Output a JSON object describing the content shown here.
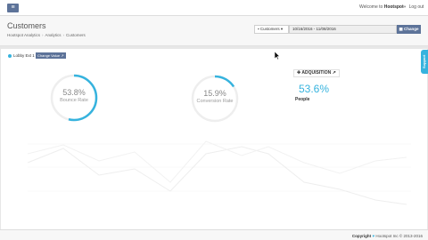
{
  "topbar": {
    "menu_icon": "hamburger-icon",
    "welcome_prefix": "Welcome to",
    "welcome_brand": "Hootspot",
    "logout_label": "Log out",
    "logout_icon": "sign-out-icon"
  },
  "header": {
    "title": "Customers",
    "breadcrumb": [
      "Hootspot Analytics",
      "Analytics",
      "Customers"
    ],
    "select_label": "Customers",
    "select_icon": "users-icon",
    "date_range": "10/16/2016 - 11/08/2016",
    "change_label": "Change",
    "change_icon": "calendar-icon"
  },
  "filter": {
    "location_label": "Lobby Ext 1",
    "change_value_label": "Change Value"
  },
  "gauges": [
    {
      "value": "53.8%",
      "label": "Bounce Rate",
      "fraction": 0.538
    },
    {
      "value": "15.9%",
      "label": "Conversion Rate",
      "fraction": 0.159
    }
  ],
  "acquisition": {
    "title": "ADQUISITION",
    "icon": "user-plus-icon",
    "value": "53.6%",
    "label": "People"
  },
  "support_tab": {
    "label": "Support"
  },
  "footer": {
    "prefix": "Copyright",
    "brand": "Hootspot Inc",
    "years": "© 2013-2016"
  },
  "colors": {
    "accent": "#36b3de",
    "button": "#5d7399",
    "page_bg": "#e7e7e7",
    "panel_bg": "#ffffff"
  }
}
